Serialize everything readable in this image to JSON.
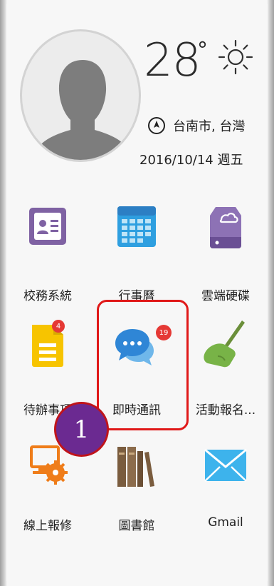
{
  "weather": {
    "temperature": "28",
    "degree_symbol": "°",
    "icon": "sun-icon",
    "location": "台南市, 台灣",
    "date": "2016/10/14 週五"
  },
  "apps": [
    {
      "label": "校務系統",
      "icon": "contact-card-icon"
    },
    {
      "label": "行事曆",
      "icon": "calendar-icon"
    },
    {
      "label": "雲端硬碟",
      "icon": "cloud-drive-icon"
    },
    {
      "label": "待辦事項",
      "icon": "todo-document-icon",
      "badge": "4"
    },
    {
      "label": "即時通訊",
      "icon": "chat-bubbles-icon",
      "badge": "19"
    },
    {
      "label": "活動報名...",
      "icon": "hand-writing-icon"
    },
    {
      "label": "線上報修",
      "icon": "repair-computer-icon"
    },
    {
      "label": "圖書館",
      "icon": "books-icon"
    },
    {
      "label": "Gmail",
      "icon": "mail-envelope-icon"
    }
  ],
  "annotation": {
    "step_number": "1"
  },
  "colors": {
    "highlight": "#e01919",
    "step_marker": "#6b2a91"
  }
}
